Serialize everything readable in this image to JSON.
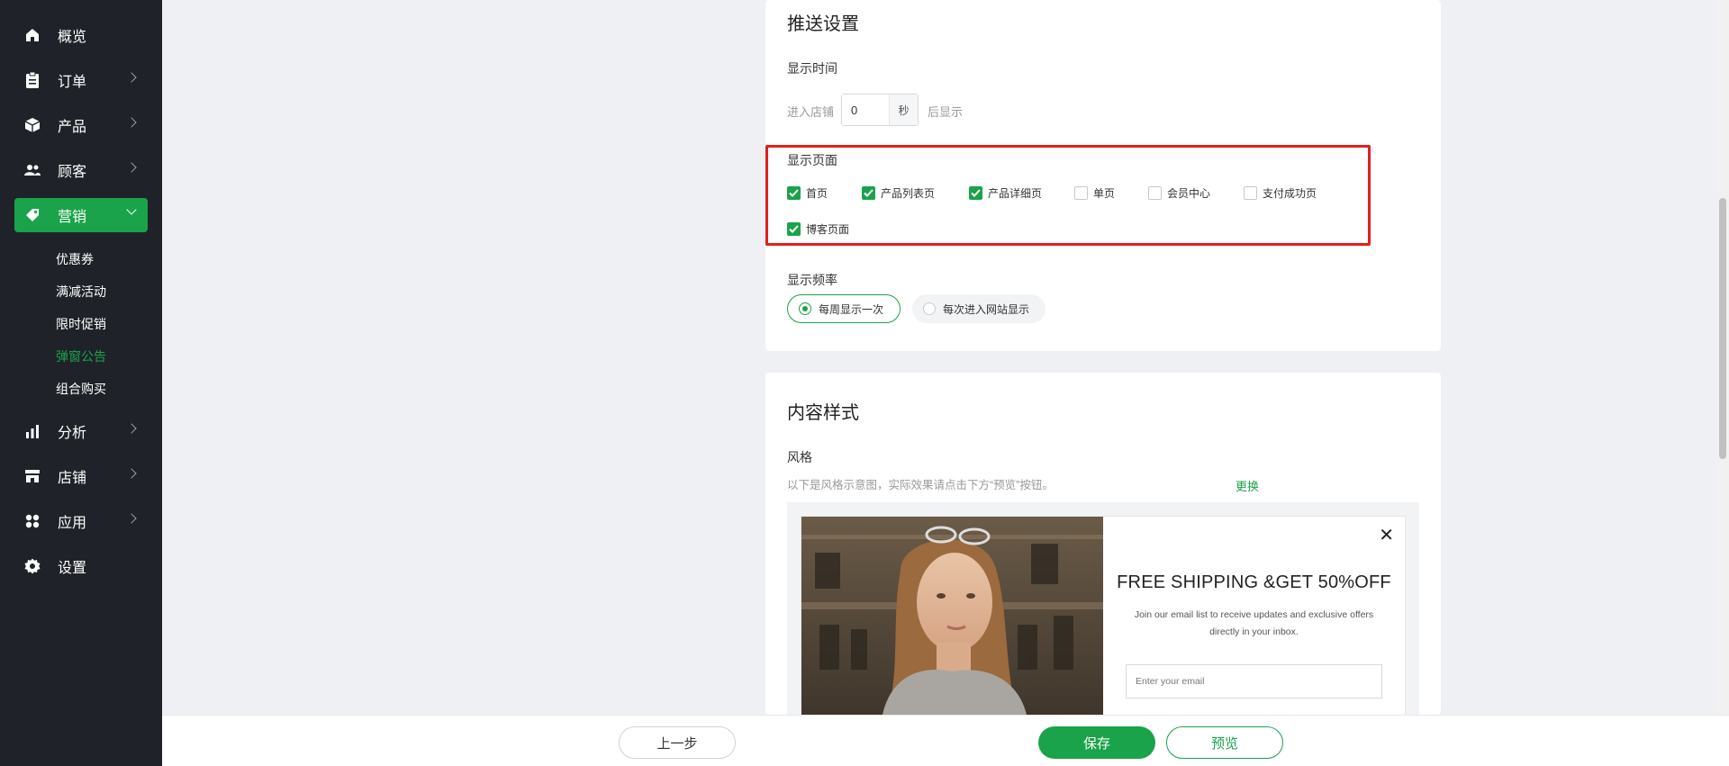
{
  "sidebar": {
    "items": [
      {
        "label": "概览",
        "icon": "home-icon"
      },
      {
        "label": "订单",
        "icon": "clipboard-icon"
      },
      {
        "label": "产品",
        "icon": "box-icon"
      },
      {
        "label": "顾客",
        "icon": "users-icon"
      },
      {
        "label": "营销",
        "icon": "tag-icon"
      },
      {
        "label": "分析",
        "icon": "bar-chart-icon"
      },
      {
        "label": "店铺",
        "icon": "store-icon"
      },
      {
        "label": "应用",
        "icon": "apps-icon"
      },
      {
        "label": "设置",
        "icon": "gear-icon"
      }
    ],
    "marketing_sub": [
      "优惠券",
      "满减活动",
      "限时促销",
      "弹窗公告",
      "组合购买"
    ],
    "active_item": "营销",
    "current_sub": "弹窗公告"
  },
  "push_settings": {
    "title": "推送设置",
    "display_time_label": "显示时间",
    "enter_store_text": "进入店铺",
    "seconds_value": "0",
    "seconds_unit": "秒",
    "after_show_text": "后显示",
    "display_pages_label": "显示页面",
    "pages": [
      {
        "label": "首页",
        "checked": true
      },
      {
        "label": "产品列表页",
        "checked": true
      },
      {
        "label": "产品详细页",
        "checked": true
      },
      {
        "label": "单页",
        "checked": false
      },
      {
        "label": "会员中心",
        "checked": false
      },
      {
        "label": "支付成功页",
        "checked": false
      },
      {
        "label": "博客页面",
        "checked": true
      }
    ],
    "frequency_label": "显示频率",
    "frequency_options": [
      {
        "label": "每周显示一次",
        "selected": true
      },
      {
        "label": "每次进入网站显示",
        "selected": false
      }
    ]
  },
  "content_style": {
    "title": "内容样式",
    "style_label": "风格",
    "hint": "以下是风格示意图，实际效果请点击下方“预览”按钮。",
    "change_link": "更换",
    "popup": {
      "title": "FREE SHIPPING &GET 50%OFF",
      "text": "Join our email list to receive updates and exclusive offers directly in your inbox.",
      "email_placeholder": "Enter your email",
      "close": "✕"
    }
  },
  "footer": {
    "prev_label": "上一步",
    "save_label": "保存",
    "preview_label": "预览"
  },
  "colors": {
    "accent": "#1aa34a",
    "sidebar_bg": "#1f2329",
    "highlight_border": "#e0201c"
  }
}
